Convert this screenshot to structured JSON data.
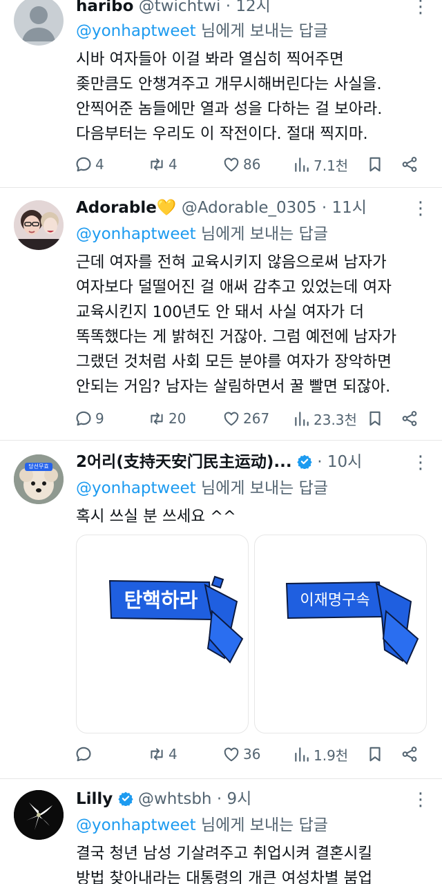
{
  "tweets": [
    {
      "name": "haribo",
      "handle": "@twichtwi",
      "time": "12시",
      "reply_to_mention": "@yonhaptweet",
      "reply_to_suffix": " 님에게 보내는 답글",
      "lines": [
        "시바 여자들아 이걸 봐라 열심히 찍어주면",
        "좆만큼도 안챙겨주고 개무시해버린다는 사실을.",
        "안찍어준 놈들에만 열과 성을 다하는 걸 보아라.",
        "다음부터는 우리도 이 작전이다. 절대 찍지마."
      ],
      "replies": "4",
      "retweets": "4",
      "likes": "86",
      "views": "7.1천"
    },
    {
      "name": "Adorable",
      "name_emoji": "💛",
      "handle": "@Adorable_0305",
      "time": "11시",
      "reply_to_mention": "@yonhaptweet",
      "reply_to_suffix": " 님에게 보내는 답글",
      "lines": [
        "근데 여자를 전혀 교육시키지 않음으로써 남자가",
        "여자보다 덜떨어진 걸 애써 감추고 있었는데 여자",
        "교육시킨지 100년도 안 돼서 사실 여자가 더",
        "똑똑했다는 게 밝혀진 거잖아. 그럼 예전에 남자가",
        "그랬던 것처럼 사회 모든 분야를 여자가 장악하면",
        "안되는 거임? 남자는 살림하면서 꿀 빨면 되잖아."
      ],
      "replies": "9",
      "retweets": "20",
      "likes": "267",
      "views": "23.3천"
    },
    {
      "name": "2어리(支持天安门民主运动)...",
      "handle": "",
      "time": "10시",
      "reply_to_mention": "@yonhaptweet",
      "reply_to_suffix": " 님에게 보내는 답글",
      "lines": [
        "혹시 쓰실 분 쓰세요 ^^"
      ],
      "avatar_badge": "당선무효",
      "media": [
        {
          "label": "탄핵하라",
          "color": "#1f5fe0"
        },
        {
          "label": "이재명구속",
          "color": "#1f5fe0"
        }
      ],
      "replies": "",
      "retweets": "4",
      "likes": "36",
      "views": "1.9천"
    },
    {
      "name": "Lilly",
      "handle": "@whtsbh",
      "time": "9시",
      "reply_to_mention": "@yonhaptweet",
      "reply_to_suffix": " 님에게 보내는 답글",
      "lines": [
        "결국 청년 남성 기살려주고 취업시켜 결혼시킬",
        "방법 찾아내라는 대통령의 개큰 여성차별 붐업"
      ]
    }
  ],
  "colors": {
    "text": "#0f1419",
    "secondary": "#536471",
    "link": "#1d9bf0",
    "border": "#e6e6e6",
    "scarf": "#1f5fe0"
  },
  "icons": [
    "reply-icon",
    "retweet-icon",
    "like-icon",
    "views-icon",
    "bookmark-icon",
    "share-icon",
    "more-icon",
    "verified-icon"
  ]
}
